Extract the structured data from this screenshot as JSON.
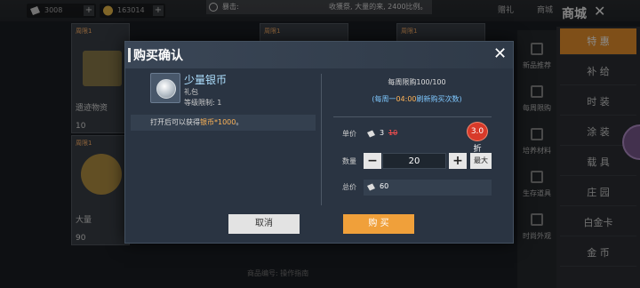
{
  "topbar": {
    "coupon_amount": "3008",
    "coin_amount": "163014",
    "ticker_prefix": "暴击:",
    "ticker_message": "收獲祭, 大量的来, 2400比例。",
    "btn_gift": "赠礼",
    "btn_mall": "商城"
  },
  "side_categories": [
    {
      "label": "新品推荐"
    },
    {
      "label": "每周限购"
    },
    {
      "label": "培养材料"
    },
    {
      "label": "生存道具"
    },
    {
      "label": "时尚外观"
    }
  ],
  "side_tabs": [
    {
      "label": "特 惠"
    },
    {
      "label": "补 给"
    },
    {
      "label": "时 装"
    },
    {
      "label": "涂 装"
    },
    {
      "label": "载 具"
    },
    {
      "label": "庄 园"
    },
    {
      "label": "白金卡"
    },
    {
      "label": "金 币"
    }
  ],
  "cards": [
    {
      "tag": "周限1",
      "price": "10",
      "label": "遗迹物资"
    },
    {
      "tag": "周限1",
      "price": "90",
      "label": "大量"
    },
    {
      "tag": "周限1",
      "price": ""
    },
    {
      "tag": "周限1",
      "price": ""
    }
  ],
  "footnote": "商品编号: 操作指南",
  "modal": {
    "title": "购买确认",
    "item_name": "少量银币",
    "item_type": "礼包",
    "item_level": "等级限制: 1",
    "desc_prefix": "打开后可以获得",
    "desc_highlight": "银币*1000",
    "desc_suffix": "。",
    "weekly_limit": "每周限购100/100",
    "refresh_prefix": "(每周一",
    "refresh_time": "04:00",
    "refresh_suffix": "刷新购买次数)",
    "unit_label": "单价",
    "unit_price": "3",
    "unit_price_old": "10",
    "discount": "3.0折",
    "qty_label": "数量",
    "qty_value": "20",
    "qty_minus": "−",
    "qty_plus": "+",
    "qty_max": "最大",
    "total_label": "总价",
    "total_value": "60",
    "cancel": "取消",
    "buy": "购 买"
  },
  "colors": {
    "accent_orange": "#f0a03a",
    "price_red": "#ff5050",
    "highlight_yellow": "#ffb457",
    "info_blue": "#7fc8ff"
  }
}
